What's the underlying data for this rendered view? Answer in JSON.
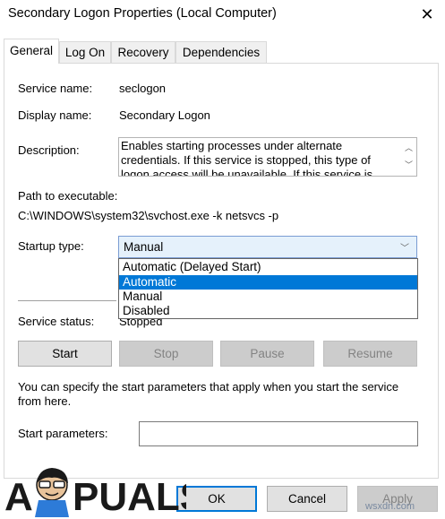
{
  "window": {
    "title": "Secondary Logon Properties (Local Computer)",
    "close_glyph": "✕"
  },
  "tabs": [
    {
      "label": "General",
      "active": true
    },
    {
      "label": "Log On",
      "active": false
    },
    {
      "label": "Recovery",
      "active": false
    },
    {
      "label": "Dependencies",
      "active": false
    }
  ],
  "general": {
    "service_name_label": "Service name:",
    "service_name": "seclogon",
    "display_name_label": "Display name:",
    "display_name": "Secondary Logon",
    "description_label": "Description:",
    "description": "Enables starting processes under alternate credentials. If this service is stopped, this type of logon access will be unavailable. If this service is disabled, any services that explicitly depend on it will fail to start.",
    "path_label": "Path to executable:",
    "path": "C:\\WINDOWS\\system32\\svchost.exe -k netsvcs -p",
    "startup_label": "Startup type:",
    "startup_value": "Manual",
    "startup_options": [
      "Automatic (Delayed Start)",
      "Automatic",
      "Manual",
      "Disabled"
    ],
    "startup_highlighted": "Automatic",
    "status_label": "Service status:",
    "status_value": "Stopped",
    "buttons": {
      "start": "Start",
      "stop": "Stop",
      "pause": "Pause",
      "resume": "Resume"
    },
    "hint": "You can specify the start parameters that apply when you start the service from here.",
    "params_label": "Start parameters:",
    "params_value": ""
  },
  "footer": {
    "ok": "OK",
    "cancel": "Cancel",
    "apply": "Apply"
  },
  "branding": {
    "logo_text": "APPUALS",
    "watermark": "wsxdn.com"
  },
  "colors": {
    "accent": "#0078d7",
    "combo_bg": "#e5f1fb",
    "disabled_text": "#838383"
  }
}
